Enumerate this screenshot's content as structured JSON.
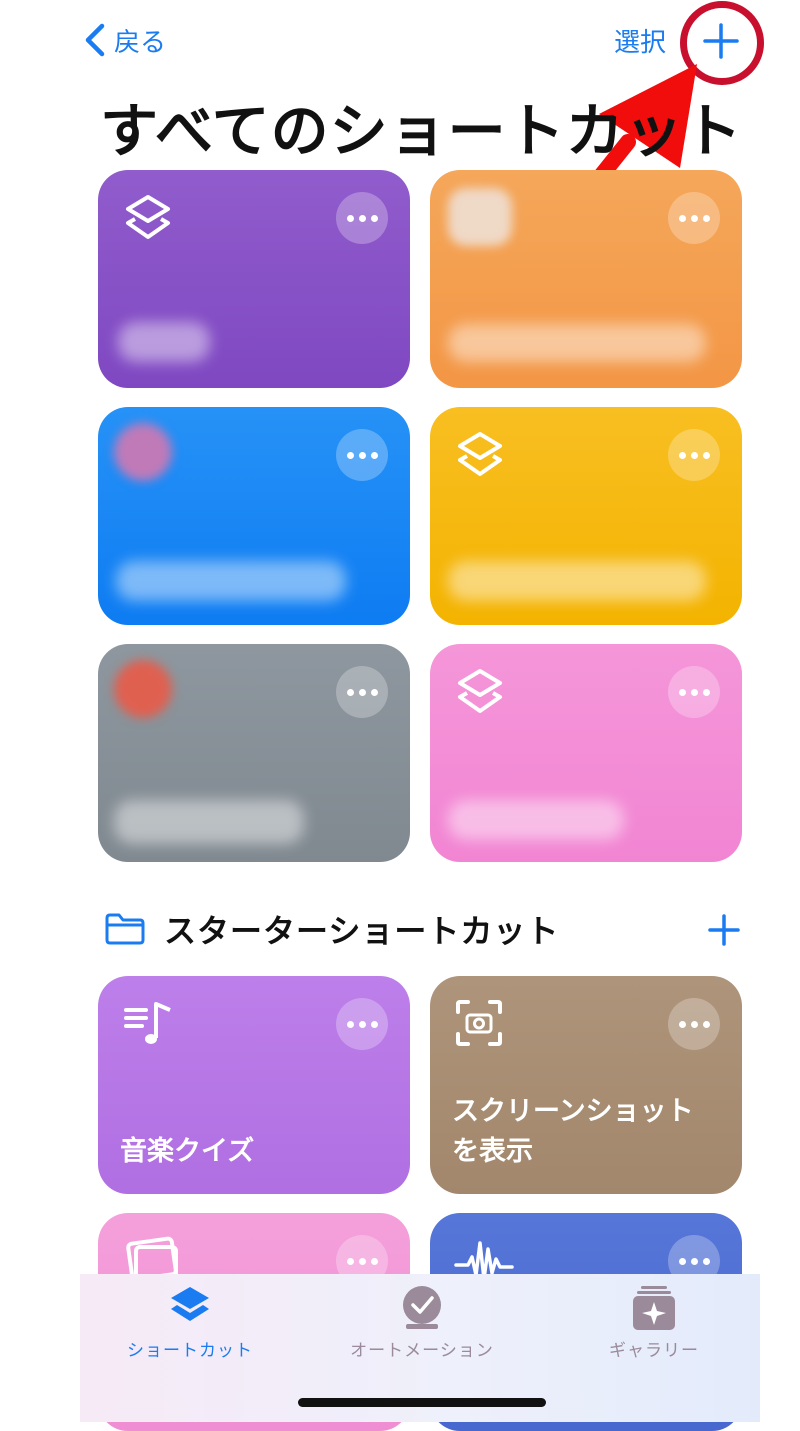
{
  "nav": {
    "back_label": "戻る",
    "select_label": "選択"
  },
  "page": {
    "title": "すべてのショートカット"
  },
  "shortcuts": [
    {
      "color": "#8a52c9",
      "icon": "layers-icon"
    },
    {
      "color": "#f3a150",
      "icon": "blurred-app-icon"
    },
    {
      "color": "#1a86f5",
      "icon": "blurred-app-icon"
    },
    {
      "color": "#f7b81a",
      "icon": "layers-icon"
    },
    {
      "color": "#8b949e",
      "icon": "blurred-app-icon"
    },
    {
      "color": "#f48fd8",
      "icon": "layers-icon"
    }
  ],
  "starter": {
    "title": "スターターショートカット",
    "items": [
      {
        "name": "音楽クイズ",
        "color": "#b97ae6",
        "icon": "music-list-icon"
      },
      {
        "name": "スクリーンショットを表示",
        "color": "#a88e74",
        "icon": "screenshot-camera-icon"
      },
      {
        "name": "",
        "color": "#f39ad6",
        "icon": "photos-icon"
      },
      {
        "name": "",
        "color": "#4d70d6",
        "icon": "waveform-icon"
      }
    ]
  },
  "tabs": [
    {
      "label": "ショートカット",
      "icon": "stack-icon",
      "color": "#1a7cf0",
      "selected": true
    },
    {
      "label": "オートメーション",
      "icon": "clock-check-icon",
      "color": "#9a8a9a",
      "selected": false
    },
    {
      "label": "ギャラリー",
      "icon": "gallery-sparkle-icon",
      "color": "#9a8a9a",
      "selected": false
    }
  ]
}
